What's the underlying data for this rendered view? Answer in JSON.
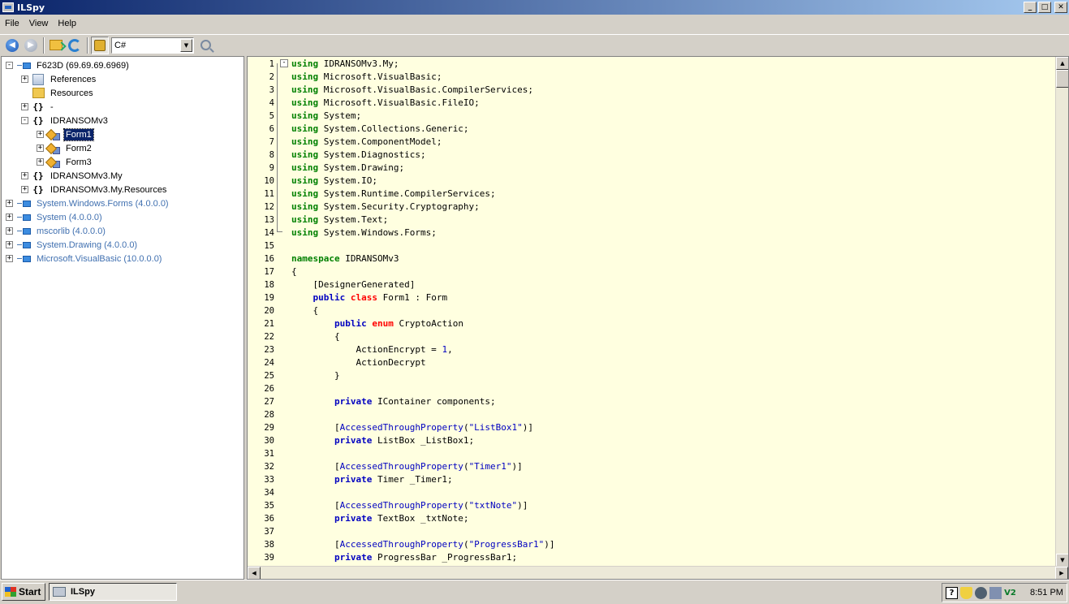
{
  "window": {
    "title": "ILSpy",
    "minimize": "_",
    "maximize": "□",
    "close": "✕"
  },
  "menu": [
    "File",
    "View",
    "Help"
  ],
  "toolbar": {
    "language": "C#",
    "dropdown_arrow": "▼",
    "back_glyph": "◀",
    "forward_glyph": "▶"
  },
  "tree": [
    {
      "label": "F623D (69.69.69.6969)",
      "icon": "assembly-icon",
      "expander": "-",
      "indent": 0,
      "style": "normal"
    },
    {
      "label": "References",
      "icon": "references-icon",
      "expander": "+",
      "indent": 1,
      "style": "normal"
    },
    {
      "label": "Resources",
      "icon": "resources-folder-icon",
      "expander": "",
      "indent": 1,
      "style": "normal"
    },
    {
      "label": "-",
      "icon": "namespace-icon",
      "expander": "+",
      "indent": 1,
      "style": "normal"
    },
    {
      "label": "IDRANSOMv3",
      "icon": "namespace-icon",
      "expander": "-",
      "indent": 1,
      "style": "normal"
    },
    {
      "label": "Form1",
      "icon": "class-icon",
      "expander": "+",
      "indent": 2,
      "style": "selected"
    },
    {
      "label": "Form2",
      "icon": "class-icon",
      "expander": "+",
      "indent": 2,
      "style": "normal"
    },
    {
      "label": "Form3",
      "icon": "class-icon",
      "expander": "+",
      "indent": 2,
      "style": "normal"
    },
    {
      "label": "IDRANSOMv3.My",
      "icon": "namespace-icon",
      "expander": "+",
      "indent": 1,
      "style": "normal"
    },
    {
      "label": "IDRANSOMv3.My.Resources",
      "icon": "namespace-icon",
      "expander": "+",
      "indent": 1,
      "style": "normal"
    },
    {
      "label": "System.Windows.Forms (4.0.0.0)",
      "icon": "assembly-icon",
      "expander": "+",
      "indent": 0,
      "style": "blue"
    },
    {
      "label": "System (4.0.0.0)",
      "icon": "assembly-icon",
      "expander": "+",
      "indent": 0,
      "style": "blue"
    },
    {
      "label": "mscorlib (4.0.0.0)",
      "icon": "assembly-icon",
      "expander": "+",
      "indent": 0,
      "style": "blue"
    },
    {
      "label": "System.Drawing (4.0.0.0)",
      "icon": "assembly-icon",
      "expander": "+",
      "indent": 0,
      "style": "blue"
    },
    {
      "label": "Microsoft.VisualBasic (10.0.0.0)",
      "icon": "assembly-icon",
      "expander": "+",
      "indent": 0,
      "style": "blue"
    }
  ],
  "code": {
    "fold_glyph": "-",
    "lines": [
      [
        [
          "using",
          "kw"
        ],
        [
          " IDRANSOMv3.My;",
          ""
        ]
      ],
      [
        [
          "using",
          "kw"
        ],
        [
          " Microsoft.VisualBasic;",
          ""
        ]
      ],
      [
        [
          "using",
          "kw"
        ],
        [
          " Microsoft.VisualBasic.CompilerServices;",
          ""
        ]
      ],
      [
        [
          "using",
          "kw"
        ],
        [
          " Microsoft.VisualBasic.FileIO;",
          ""
        ]
      ],
      [
        [
          "using",
          "kw"
        ],
        [
          " System;",
          ""
        ]
      ],
      [
        [
          "using",
          "kw"
        ],
        [
          " System.Collections.Generic;",
          ""
        ]
      ],
      [
        [
          "using",
          "kw"
        ],
        [
          " System.ComponentModel;",
          ""
        ]
      ],
      [
        [
          "using",
          "kw"
        ],
        [
          " System.Diagnostics;",
          ""
        ]
      ],
      [
        [
          "using",
          "kw"
        ],
        [
          " System.Drawing;",
          ""
        ]
      ],
      [
        [
          "using",
          "kw"
        ],
        [
          " System.IO;",
          ""
        ]
      ],
      [
        [
          "using",
          "kw"
        ],
        [
          " System.Runtime.CompilerServices;",
          ""
        ]
      ],
      [
        [
          "using",
          "kw"
        ],
        [
          " System.Security.Cryptography;",
          ""
        ]
      ],
      [
        [
          "using",
          "kw"
        ],
        [
          " System.Text;",
          ""
        ]
      ],
      [
        [
          "using",
          "kw"
        ],
        [
          " System.Windows.Forms;",
          ""
        ]
      ],
      [],
      [
        [
          "namespace",
          "kw"
        ],
        [
          " IDRANSOMv3",
          ""
        ]
      ],
      [
        [
          "{",
          ""
        ]
      ],
      [
        [
          "    [DesignerGenerated]",
          ""
        ]
      ],
      [
        [
          "    ",
          ""
        ],
        [
          "public",
          "kwb"
        ],
        [
          " ",
          ""
        ],
        [
          "class",
          "kwr"
        ],
        [
          " Form1 : Form",
          ""
        ]
      ],
      [
        [
          "    {",
          ""
        ]
      ],
      [
        [
          "        ",
          ""
        ],
        [
          "public",
          "kwb"
        ],
        [
          " ",
          ""
        ],
        [
          "enum",
          "kwr"
        ],
        [
          " CryptoAction",
          ""
        ]
      ],
      [
        [
          "        {",
          ""
        ]
      ],
      [
        [
          "            ActionEncrypt = ",
          ""
        ],
        [
          "1",
          "num"
        ],
        [
          ",",
          ""
        ]
      ],
      [
        [
          "            ActionDecrypt",
          ""
        ]
      ],
      [
        [
          "        }",
          ""
        ]
      ],
      [],
      [
        [
          "        ",
          ""
        ],
        [
          "private",
          "kwb"
        ],
        [
          " IContainer components;",
          ""
        ]
      ],
      [],
      [
        [
          "        [",
          ""
        ],
        [
          "AccessedThroughProperty",
          "attr"
        ],
        [
          "(",
          ""
        ],
        [
          "\"ListBox1\"",
          "str"
        ],
        [
          ")]",
          ""
        ]
      ],
      [
        [
          "        ",
          ""
        ],
        [
          "private",
          "kwb"
        ],
        [
          " ListBox _ListBox1;",
          ""
        ]
      ],
      [],
      [
        [
          "        [",
          ""
        ],
        [
          "AccessedThroughProperty",
          "attr"
        ],
        [
          "(",
          ""
        ],
        [
          "\"Timer1\"",
          "str"
        ],
        [
          ")]",
          ""
        ]
      ],
      [
        [
          "        ",
          ""
        ],
        [
          "private",
          "kwb"
        ],
        [
          " Timer _Timer1;",
          ""
        ]
      ],
      [],
      [
        [
          "        [",
          ""
        ],
        [
          "AccessedThroughProperty",
          "attr"
        ],
        [
          "(",
          ""
        ],
        [
          "\"txtNote\"",
          "str"
        ],
        [
          ")]",
          ""
        ]
      ],
      [
        [
          "        ",
          ""
        ],
        [
          "private",
          "kwb"
        ],
        [
          " TextBox _txtNote;",
          ""
        ]
      ],
      [],
      [
        [
          "        [",
          ""
        ],
        [
          "AccessedThroughProperty",
          "attr"
        ],
        [
          "(",
          ""
        ],
        [
          "\"ProgressBar1\"",
          "str"
        ],
        [
          ")]",
          ""
        ]
      ],
      [
        [
          "        ",
          ""
        ],
        [
          "private",
          "kwb"
        ],
        [
          " ProgressBar _ProgressBar1;",
          ""
        ]
      ]
    ]
  },
  "scrollbars": {
    "up": "▲",
    "down": "▼",
    "left": "◀",
    "right": "▶"
  },
  "taskbar": {
    "start_label": "Start",
    "task_label": "ILSpy",
    "tray_help": "?",
    "tray_vl": "V2",
    "clock": "8:51 PM"
  }
}
